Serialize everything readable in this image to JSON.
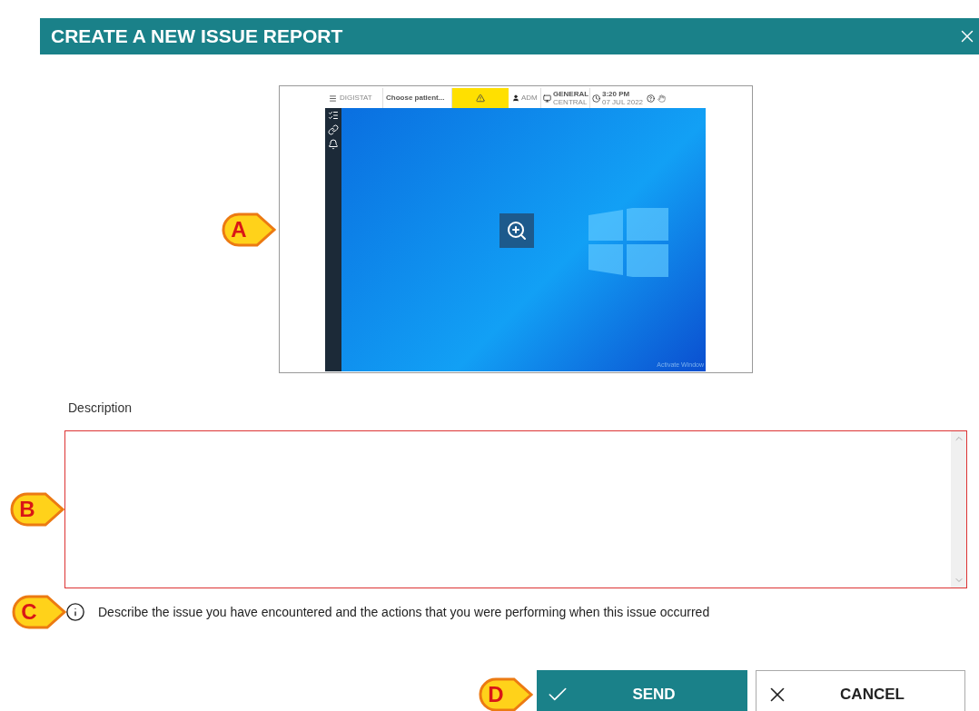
{
  "dialog": {
    "title": "CREATE A NEW ISSUE REPORT"
  },
  "screenshot": {
    "callout": "A",
    "topbar": {
      "app": "DIGISTAT",
      "patient": "Choose patient...",
      "user": "ADM",
      "station_line1": "GENERAL",
      "station_line2": "CENTRAL",
      "time": "3:20 PM",
      "date": "07 JUL 2022"
    },
    "watermark_text": "Activate Window"
  },
  "description": {
    "label": "Description",
    "callout": "B"
  },
  "info": {
    "callout": "C",
    "text": "Describe the issue you have encountered and the actions that you were performing when this issue occurred"
  },
  "actions": {
    "callout": "D",
    "buttons": [
      {
        "kind": "primary",
        "label": "SEND"
      },
      {
        "kind": "secondary",
        "label": "CANCEL"
      }
    ]
  }
}
